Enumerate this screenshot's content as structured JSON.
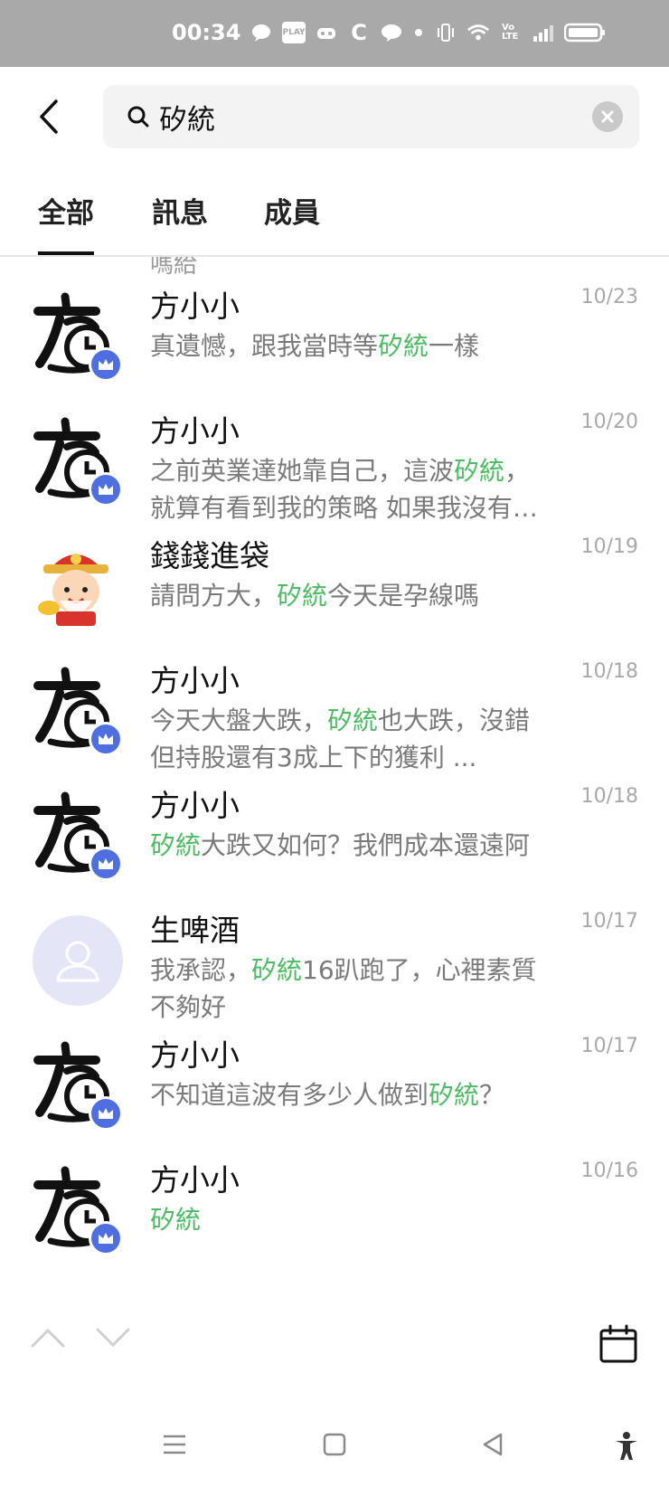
{
  "status_bar": {
    "time": "00:34",
    "icons": [
      "chat-bubble-icon",
      "play-together-icon",
      "game-icon",
      "c-app-icon",
      "line-icon",
      "dot-icon",
      "vibrate-icon",
      "wifi-icon",
      "volte-icon",
      "signal-icon",
      "battery-icon"
    ],
    "small_labels": {
      "play": "PLAY",
      "volte": "Vo LTE"
    }
  },
  "search": {
    "value": "矽統",
    "placeholder": ""
  },
  "tabs": [
    {
      "label": "全部",
      "active": true
    },
    {
      "label": "訊息",
      "active": false
    },
    {
      "label": "成員",
      "active": false
    }
  ],
  "partial_row_text": "嗎給",
  "results": [
    {
      "name": "方小小",
      "date": "10/23",
      "avatar": "fang-logo-icon",
      "badge": "crown-icon",
      "message": [
        {
          "t": "真遺憾，跟我當時等"
        },
        {
          "t": "矽統",
          "hl": true
        },
        {
          "t": "一樣"
        }
      ]
    },
    {
      "name": "方小小",
      "date": "10/20",
      "avatar": "fang-logo-icon",
      "badge": "crown-icon",
      "message": [
        {
          "t": "之前英業達她靠自己，這波"
        },
        {
          "t": "矽統",
          "hl": true
        },
        {
          "t": "，就算有看到我的策略 如果我沒有提醒大家"
        }
      ]
    },
    {
      "name": "錢錢進袋",
      "date": "10/19",
      "avatar": "fortune-god-icon",
      "badge": "",
      "message": [
        {
          "t": "請問方大，"
        },
        {
          "t": "矽統",
          "hl": true
        },
        {
          "t": "今天是孕線嗎"
        }
      ]
    },
    {
      "name": "方小小",
      "date": "10/18",
      "avatar": "fang-logo-icon",
      "badge": "crown-icon",
      "message": [
        {
          "t": "今天大盤大跌，"
        },
        {
          "t": "矽統",
          "hl": true
        },
        {
          "t": "也大跌，沒錯  但持股還有3成上下的獲利  ..."
        }
      ]
    },
    {
      "name": "方小小",
      "date": "10/18",
      "avatar": "fang-logo-icon",
      "badge": "crown-icon",
      "message": [
        {
          "t": "矽統",
          "hl": true
        },
        {
          "t": "大跌又如何？我們成本還遠阿"
        }
      ]
    },
    {
      "name": "生啤酒",
      "date": "10/17",
      "avatar": "default-user-icon",
      "badge": "",
      "message": [
        {
          "t": "我承認，"
        },
        {
          "t": "矽統",
          "hl": true
        },
        {
          "t": "16趴跑了，心裡素質不夠好"
        }
      ]
    },
    {
      "name": "方小小",
      "date": "10/17",
      "avatar": "fang-logo-icon",
      "badge": "crown-icon",
      "message": [
        {
          "t": "不知道這波有多少人做到"
        },
        {
          "t": "矽統",
          "hl": true
        },
        {
          "t": "？"
        }
      ]
    },
    {
      "name": "方小小",
      "date": "10/16",
      "avatar": "fang-logo-icon",
      "badge": "crown-icon",
      "message": [
        {
          "t": "矽統",
          "hl": true
        }
      ]
    }
  ],
  "colors": {
    "highlight": "#4cbc63",
    "badge": "#4f6fe0",
    "status_bar": "#a9a9a9"
  }
}
